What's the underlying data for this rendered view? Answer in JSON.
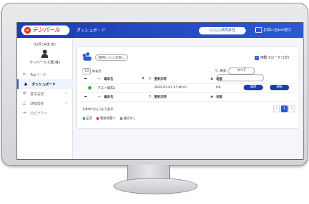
{
  "header": {
    "logo_mark": "∞",
    "logo_text": "テンバール",
    "title": "ダッシュボード",
    "company": "○○○○株式会社",
    "contact": "お問い合わせ窓口"
  },
  "sidebar": {
    "date": "01月14日(水)",
    "user_name": "テンバール工業(株)",
    "items": [
      {
        "icon": "⌂",
        "label": "Topページ"
      },
      {
        "icon": "▲",
        "label": "ダッシュボード"
      },
      {
        "icon": "⚙",
        "label": "基本設定",
        "arrow": "›"
      },
      {
        "icon": "△",
        "label": "通知設定",
        "arrow": "›"
      },
      {
        "icon": "⇥",
        "label": "ログアウト"
      }
    ]
  },
  "main": {
    "group_select": "(仮称) ○○○計測",
    "auto_reload": "自動リロード(1分)",
    "per_page_value": "10",
    "per_page_label": "件表示",
    "search_label": "検索:",
    "search_select": "すべて",
    "columns": {
      "terminal": "端末名",
      "updated": "更新日時",
      "status": "状態"
    },
    "row": {
      "terminal": "テスト端末1",
      "updated": "2022-02-03 17:46:01",
      "status": "OK",
      "history_btn": "履歴",
      "notify_btn": "通知"
    },
    "count_text": "1件中1から1まで表示",
    "pager": {
      "prev": "«",
      "current": "1",
      "next": "»"
    },
    "legend": [
      {
        "label": "正常",
        "color": "#2bb34a"
      },
      {
        "label": "電池残量少",
        "color": "#e23b3b"
      },
      {
        "label": "通信なし",
        "color": "#888888"
      }
    ]
  },
  "colors": {
    "accent": "#1f3bb3",
    "ok": "#2bb34a"
  }
}
